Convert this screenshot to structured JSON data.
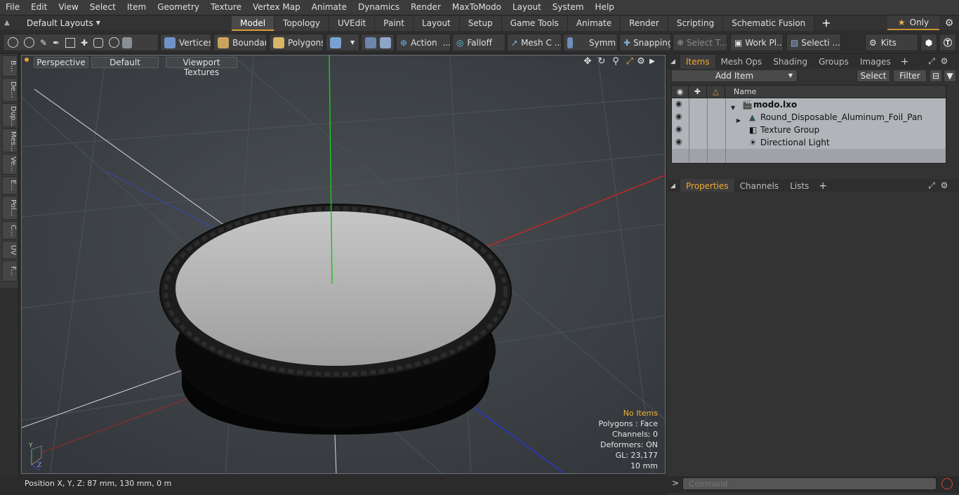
{
  "menu": [
    "File",
    "Edit",
    "View",
    "Select",
    "Item",
    "Geometry",
    "Texture",
    "Vertex Map",
    "Animate",
    "Dynamics",
    "Render",
    "MaxToModo",
    "Layout",
    "System",
    "Help"
  ],
  "layout": {
    "selector": "Default Layouts",
    "tabs": [
      "Model",
      "Topology",
      "UVEdit",
      "Paint",
      "Layout",
      "Setup",
      "Game Tools",
      "Animate",
      "Render",
      "Scripting",
      "Schematic Fusion"
    ],
    "active_tab": "Model",
    "only_label": "Only"
  },
  "toolbar": {
    "vertices": "Vertices",
    "boundary": "Boundary",
    "polygons": "Polygons",
    "action": "Action",
    "falloff": "Falloff",
    "mesh_c": "Mesh C ...",
    "symm": "Symm ...",
    "snapping": "Snapping",
    "select_t": "Select T...",
    "work_pl": "Work Pl...",
    "selecti": "Selecti ...",
    "kits": "Kits"
  },
  "left_tabs": [
    "B...",
    "De...",
    "Dup...",
    "Mes...",
    "Ve...",
    "E...",
    "Pol...",
    "C...",
    "UV",
    "F..."
  ],
  "viewport": {
    "view_mode": "Perspective",
    "shading": "Default",
    "textures": "Viewport Textures",
    "info": {
      "selection": "No Items",
      "polygons": "Polygons : Face",
      "channels": "Channels: 0",
      "deformers": "Deformers: ON",
      "gl": "GL: 23,177",
      "scale": "10 mm"
    },
    "axis_y": "Y",
    "axis_z": "Z"
  },
  "status": {
    "position": "Position X, Y, Z:  87 mm, 130 mm, 0 m"
  },
  "items_panel": {
    "tabs": [
      "Items",
      "Mesh Ops",
      "Shading",
      "Groups",
      "Images"
    ],
    "active_tab": "Items",
    "add_item": "Add Item",
    "select": "Select",
    "filter": "Filter",
    "column_name": "Name",
    "rows": [
      {
        "name": "modo.lxo"
      },
      {
        "name": "Round_Disposable_Aluminum_Foil_Pan"
      },
      {
        "name": "Texture Group"
      },
      {
        "name": "Directional Light"
      }
    ]
  },
  "properties_panel": {
    "tabs": [
      "Properties",
      "Channels",
      "Lists"
    ],
    "active_tab": "Properties"
  },
  "command": {
    "placeholder": "Command",
    "prompt": ">"
  },
  "colors": {
    "accent": "#f0a830",
    "viewport_bg": "#3c4044",
    "axis_x": "#c02828",
    "axis_y": "#22c022",
    "axis_z": "#2838b0"
  }
}
